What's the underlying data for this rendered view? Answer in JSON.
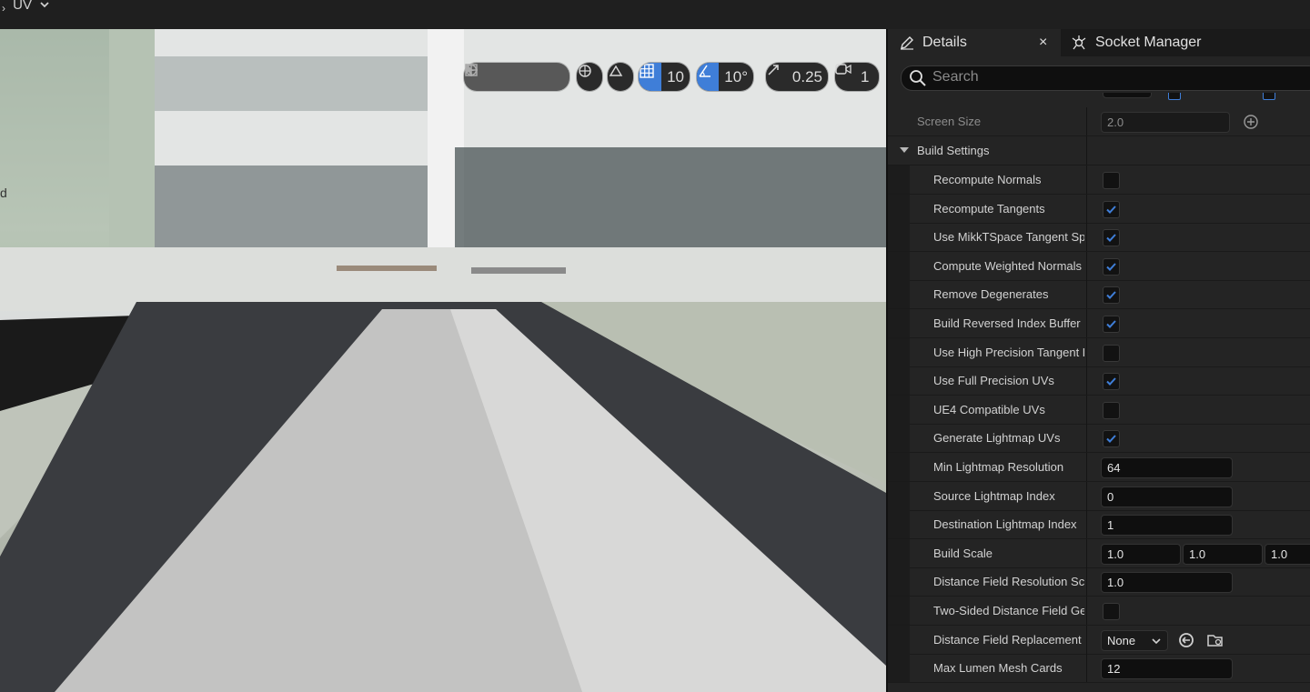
{
  "topbar": {
    "mode_label": "UV",
    "chevron": "chevron-down-icon"
  },
  "viewport": {
    "side_letter": "d",
    "toolbar": {
      "grid_snap_value": "10",
      "rotation_snap_value": "10°",
      "scale_snap_value": "0.25",
      "camera_speed_value": "1"
    },
    "accent_color": "#3f7ed8"
  },
  "details": {
    "tabs": [
      {
        "label": "Details",
        "icon": "pencil-icon"
      },
      {
        "label": "Socket Manager",
        "icon": "socket-icon"
      }
    ],
    "close_label": "×",
    "search_placeholder": "Search",
    "screen_size": {
      "label": "Screen Size",
      "value": "2.0"
    },
    "section_title": "Build Settings",
    "rows": [
      {
        "label": "Recompute Normals",
        "type": "checkbox",
        "checked": false
      },
      {
        "label": "Recompute Tangents",
        "type": "checkbox",
        "checked": true
      },
      {
        "label": "Use MikkTSpace Tangent Spa",
        "type": "checkbox",
        "checked": true
      },
      {
        "label": "Compute Weighted Normals",
        "type": "checkbox",
        "checked": true
      },
      {
        "label": "Remove Degenerates",
        "type": "checkbox",
        "checked": true
      },
      {
        "label": "Build Reversed Index Buffer",
        "type": "checkbox",
        "checked": true
      },
      {
        "label": "Use High Precision Tangent Ba",
        "type": "checkbox",
        "checked": false
      },
      {
        "label": "Use Full Precision UVs",
        "type": "checkbox",
        "checked": true
      },
      {
        "label": "UE4 Compatible UVs",
        "type": "checkbox",
        "checked": false
      },
      {
        "label": "Generate Lightmap UVs",
        "type": "checkbox",
        "checked": true
      },
      {
        "label": "Min Lightmap Resolution",
        "type": "number",
        "value": "64"
      },
      {
        "label": "Source Lightmap Index",
        "type": "number",
        "value": "0"
      },
      {
        "label": "Destination Lightmap Index",
        "type": "number",
        "value": "1"
      },
      {
        "label": "Build Scale",
        "type": "vector",
        "values": [
          "1.0",
          "1.0",
          "1.0"
        ]
      },
      {
        "label": "Distance Field Resolution Scal",
        "type": "number",
        "value": "1.0"
      },
      {
        "label": "Two-Sided Distance Field Gen",
        "type": "checkbox",
        "checked": false
      },
      {
        "label": "Distance Field Replacement M",
        "type": "asset",
        "value": "None"
      },
      {
        "label": "Max Lumen Mesh Cards",
        "type": "number",
        "value": "12"
      }
    ]
  }
}
